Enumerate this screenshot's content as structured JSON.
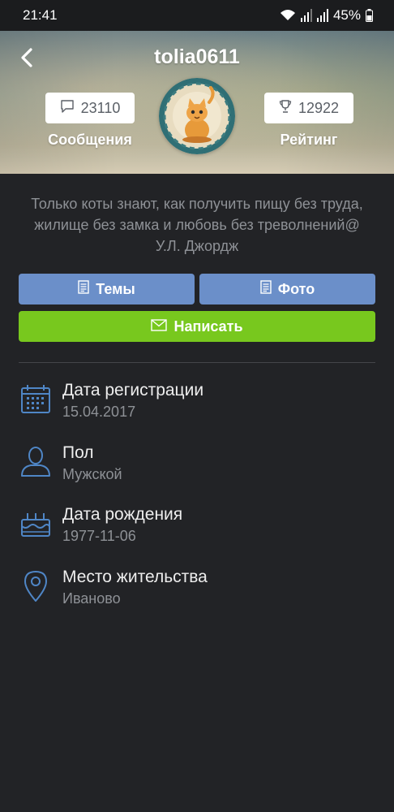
{
  "status_bar": {
    "time": "21:41",
    "battery": "45%",
    "icons": [
      "wifi-icon",
      "signal-icon",
      "signal-icon",
      "battery-icon"
    ]
  },
  "profile": {
    "username": "tolia0611",
    "messages_count": "23110",
    "messages_label": "Сообщения",
    "rating_count": "12922",
    "rating_label": "Рейтинг",
    "bio": "Только коты знают, как получить пищу без труда, жилище без замка и любовь без треволнений@ У.Л. Джордж"
  },
  "buttons": {
    "topics": "Темы",
    "photos": "Фото",
    "write": "Написать"
  },
  "info": [
    {
      "title": "Дата регистрации",
      "value": "15.04.2017",
      "icon": "calendar-icon"
    },
    {
      "title": "Пол",
      "value": "Мужской",
      "icon": "person-icon"
    },
    {
      "title": "Дата рождения",
      "value": "1977-11-06",
      "icon": "cake-icon"
    },
    {
      "title": "Место жительства",
      "value": "Иваново",
      "icon": "location-pin-icon"
    }
  ],
  "colors": {
    "background": "#222326",
    "accent_blue": "#6b8fc9",
    "accent_green": "#78c81e",
    "icon_blue": "#4f86c6",
    "muted_text": "#8e9196"
  }
}
